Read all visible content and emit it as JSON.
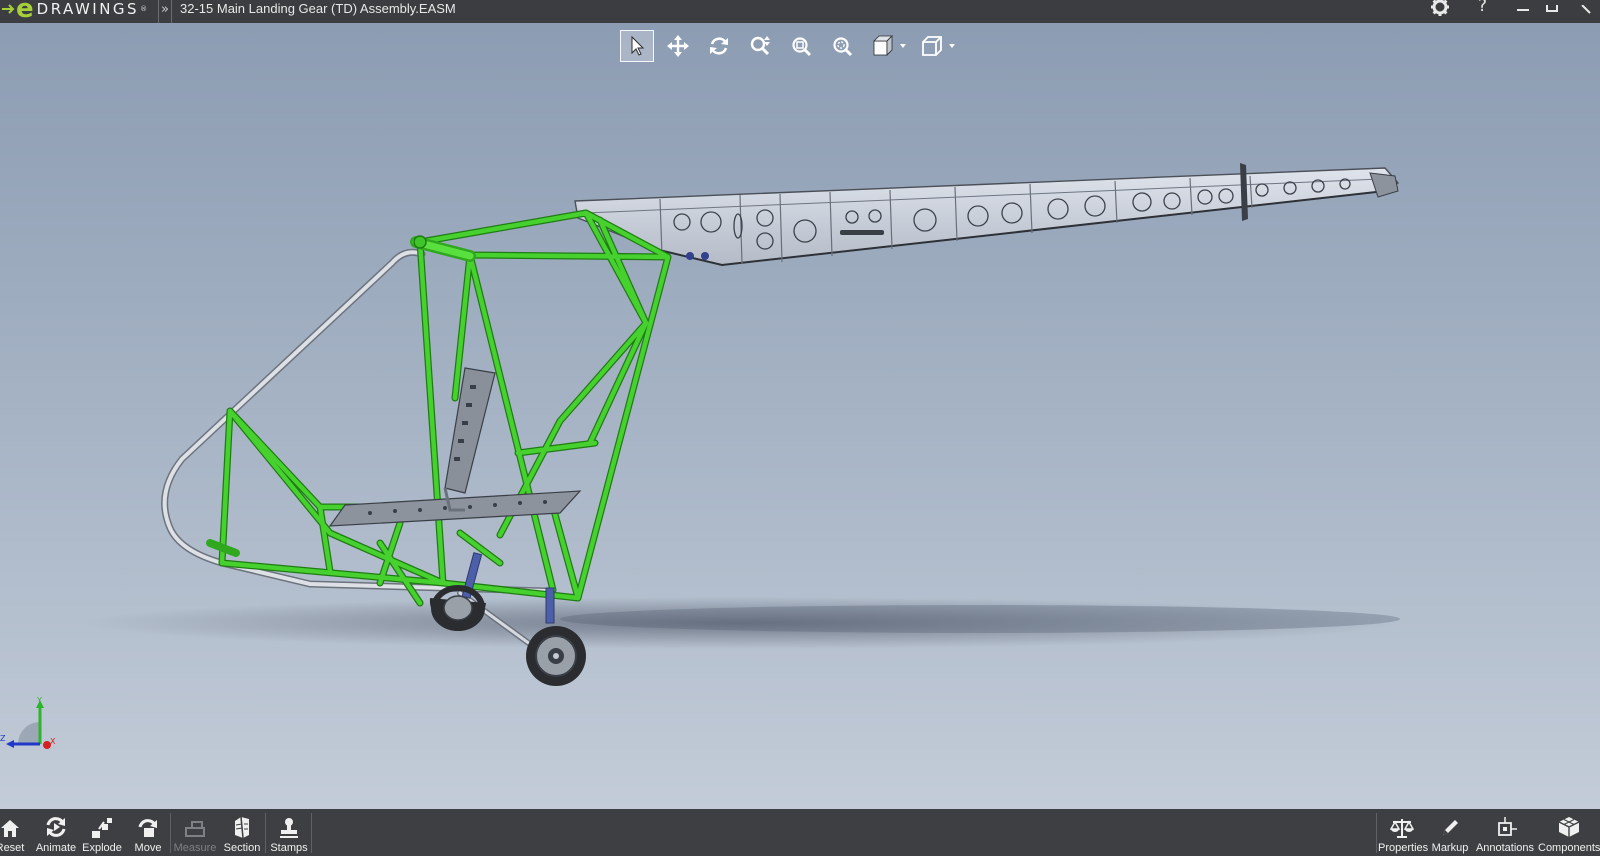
{
  "app": {
    "logo_e": "e",
    "logo_word": "DRAWINGS",
    "logo_reg": "®",
    "chevron": "»",
    "document_title": "32-15 Main Landing Gear (TD) Assembly.EASM"
  },
  "titlebar_icons": [
    "gear-icon",
    "help-icon",
    "minimize-icon",
    "maximize-icon"
  ],
  "titlebar_help": "?",
  "top_toolbar": [
    {
      "name": "select-tool",
      "icon": "arrow-pointer-icon",
      "active": true
    },
    {
      "name": "pan-tool",
      "icon": "move-arrows-icon"
    },
    {
      "name": "rotate-tool",
      "icon": "rotate-icon"
    },
    {
      "name": "zoom-tool",
      "icon": "zoom-icon"
    },
    {
      "name": "zoom-fit-tool",
      "icon": "zoom-fit-icon"
    },
    {
      "name": "zoom-area-tool",
      "icon": "zoom-area-icon"
    },
    {
      "name": "views-tool",
      "icon": "views-icon",
      "dropdown": true
    },
    {
      "name": "display-style-tool",
      "icon": "cube-icon",
      "dropdown": true
    }
  ],
  "bottom_left_tools": [
    {
      "label": "Reset",
      "icon": "home-icon"
    },
    {
      "label": "Animate",
      "icon": "animate-icon"
    },
    {
      "label": "Explode",
      "icon": "explode-icon"
    },
    {
      "label": "Move",
      "icon": "move-component-icon"
    },
    {
      "label": "Measure",
      "icon": "measure-icon",
      "disabled": true
    },
    {
      "label": "Section",
      "icon": "section-icon"
    },
    {
      "label": "Stamps",
      "icon": "stamp-icon"
    }
  ],
  "bottom_right_tools": [
    {
      "label": "Properties",
      "icon": "scales-icon"
    },
    {
      "label": "Markup",
      "icon": "pencil-icon"
    },
    {
      "label": "Annotations",
      "icon": "annotation-icon"
    },
    {
      "label": "Components",
      "icon": "components-icon"
    }
  ],
  "triad": {
    "y_label": "Y",
    "z_label": "Z",
    "x_label": "X"
  },
  "colors": {
    "frame_green": "#3fc42a",
    "accent_lime": "#a6d03a",
    "bar_dark": "#3d3f43"
  }
}
